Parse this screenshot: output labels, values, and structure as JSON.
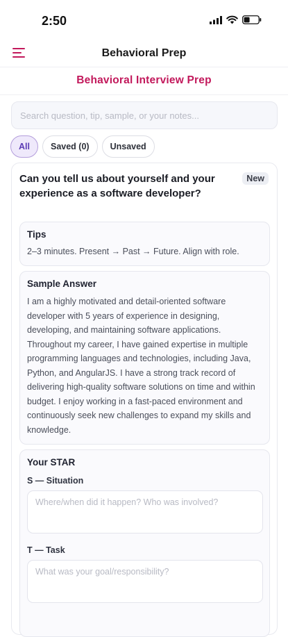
{
  "status": {
    "time": "2:50"
  },
  "header": {
    "title": "Behavioral Prep"
  },
  "page": {
    "title": "Behavioral Interview Prep"
  },
  "search": {
    "placeholder": "Search question, tip, sample, or your notes..."
  },
  "filters": [
    {
      "label": "All",
      "active": true
    },
    {
      "label": "Saved (0)",
      "active": false
    },
    {
      "label": "Unsaved",
      "active": false
    }
  ],
  "card": {
    "question": "Can you tell us about yourself and your experience as a software developer?",
    "badge": "New",
    "tips": {
      "title": "Tips",
      "text": "2–3 minutes. Present → Past → Future. Align with role."
    },
    "sample": {
      "title": "Sample Answer",
      "text": "I am a highly motivated and detail-oriented software developer with 5 years of experience in designing, developing, and maintaining software applications. Throughout my career, I have gained expertise in multiple programming languages and technologies, including Java, Python, and AngularJS. I have a strong track record of delivering high-quality software solutions on time and within budget. I enjoy working in a fast-paced environment and continuously seek new challenges to expand my skills and knowledge."
    },
    "star": {
      "title": "Your STAR",
      "situation": {
        "label": "S — Situation",
        "placeholder": "Where/when did it happen? Who was involved?"
      },
      "task": {
        "label": "T — Task",
        "placeholder": "What was your goal/responsibility?"
      }
    }
  },
  "colors": {
    "accent": "#c2185b",
    "chip_active": "#5b3bb5"
  }
}
